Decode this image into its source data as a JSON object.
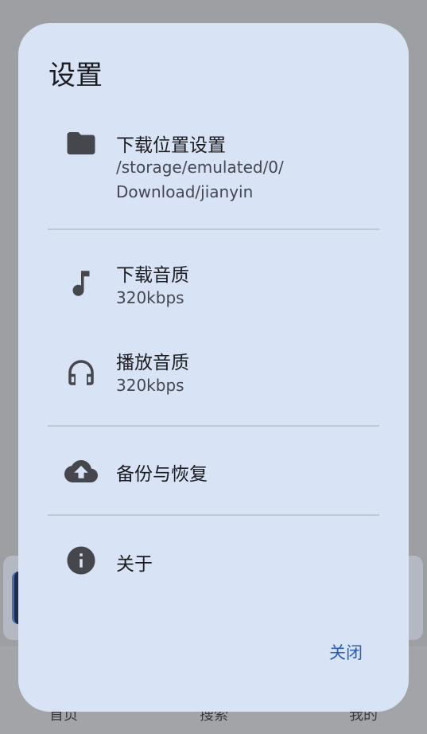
{
  "background": {
    "nav": {
      "home": "首页",
      "search": "搜索",
      "mine": "我的"
    }
  },
  "dialog": {
    "title": "设置",
    "items": [
      {
        "icon": "folder-icon",
        "label": "下载位置设置",
        "value": "/storage/emulated/0/\nDownload/jianyin"
      },
      {
        "icon": "music-note-icon",
        "label": "下载音质",
        "value": "320kbps"
      },
      {
        "icon": "headphones-icon",
        "label": "播放音质",
        "value": "320kbps"
      },
      {
        "icon": "cloud-upload-icon",
        "label": "备份与恢复"
      },
      {
        "icon": "info-icon",
        "label": "关于"
      }
    ],
    "close_label": "关闭"
  },
  "colors": {
    "dialog_bg": "#d9e3f6",
    "accent": "#2a5bb8",
    "icon": "#46474d"
  }
}
